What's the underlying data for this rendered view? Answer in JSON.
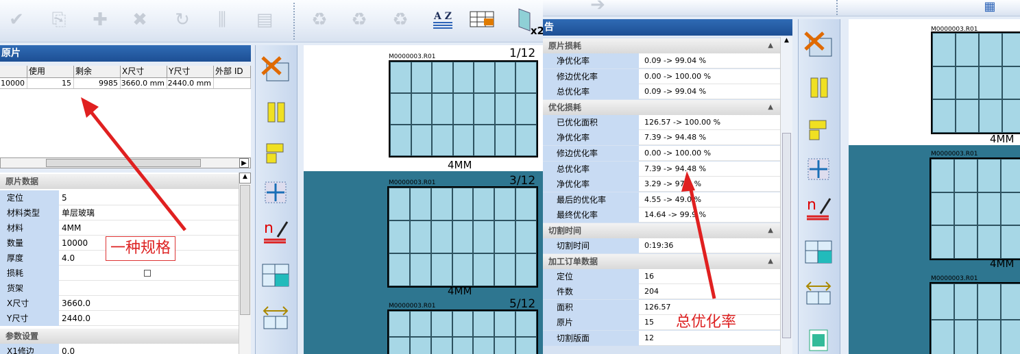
{
  "left": {
    "panel_title": "原片",
    "table": {
      "headers": [
        "使用",
        "剩余",
        "X尺寸",
        "Y尺寸",
        "外部 ID"
      ],
      "row": [
        "10000",
        "15",
        "9985",
        "3660.0 mm",
        "2440.0 mm"
      ]
    },
    "props": {
      "category": "原片数据",
      "rows": [
        {
          "k": "定位",
          "v": "5"
        },
        {
          "k": "材料类型",
          "v": "单层玻璃"
        },
        {
          "k": "材料",
          "v": "4MM"
        },
        {
          "k": "数量",
          "v": "10000"
        },
        {
          "k": "厚度",
          "v": "4.0"
        },
        {
          "k": "损耗",
          "v": ""
        },
        {
          "k": "货架",
          "v": ""
        },
        {
          "k": "X尺寸",
          "v": "3660.0"
        },
        {
          "k": "Y尺寸",
          "v": "2440.0"
        }
      ],
      "category2": "参数设置",
      "row_last": {
        "k": "X1修边",
        "v": "0.0"
      }
    },
    "annotation": "一种规格",
    "toolbar_icons": [
      "check-icon",
      "transfer-icon",
      "add-icon",
      "delete-icon",
      "undo-icon",
      "sort-icon",
      "layout-icon",
      "refresh-icon",
      "refresh-icon",
      "refresh-icon",
      "az-sort-icon",
      "edit-grid-icon",
      "copy-x2-icon"
    ],
    "x2": "x2",
    "az": "A Z",
    "sheets": [
      {
        "id": "M0000003.R01",
        "page": "1/12",
        "material": "4MM"
      },
      {
        "id": "M0000003.R01",
        "page": "3/12",
        "material": "4MM"
      },
      {
        "id": "M0000003.R01",
        "page": "5/12",
        "material": ""
      }
    ]
  },
  "right": {
    "panel_title": "告",
    "sections": [
      {
        "title": "原片损耗",
        "rows": [
          {
            "k": "净优化率",
            "v": "0.09 -> 99.04 %"
          },
          {
            "k": "修边优化率",
            "v": "0.00 -> 100.00 %"
          },
          {
            "k": "总优化率",
            "v": "0.09 -> 99.04 %"
          }
        ]
      },
      {
        "title": "优化损耗",
        "rows": [
          {
            "k": "已优化面积",
            "v": "126.57 -> 100.00 %"
          },
          {
            "k": "净优化率",
            "v": "7.39 -> 94.48 %"
          },
          {
            "k": "修边优化率",
            "v": "0.00 -> 100.00 %"
          },
          {
            "k": "总优化率",
            "v": "7.39 -> 94.48 %"
          },
          {
            "k": "净优化率",
            "v": "3.29 -> 97.5 %"
          },
          {
            "k": "最后的优化率",
            "v": "4.55 -> 49.0 %"
          },
          {
            "k": "最终优化率",
            "v": "14.64 -> 99.9 %"
          }
        ]
      },
      {
        "title": "切割时间",
        "rows": [
          {
            "k": "切割时间",
            "v": "0:19:36"
          }
        ]
      },
      {
        "title": "加工订单数据",
        "rows": [
          {
            "k": "定位",
            "v": "16"
          },
          {
            "k": "件数",
            "v": "204"
          },
          {
            "k": "面积",
            "v": "126.57"
          },
          {
            "k": "原片",
            "v": "15"
          },
          {
            "k": "切割版面",
            "v": "12"
          }
        ]
      }
    ],
    "annotation": "总优化率",
    "sheets": [
      {
        "id": "M0000003.R01",
        "material": "4MM"
      },
      {
        "id": "M0000003.R01",
        "material": "4MM"
      },
      {
        "id": "M0000003.R01",
        "material": ""
      }
    ]
  },
  "colors": {
    "glass": "#a7d7e6",
    "panel_title": "#1d4f94",
    "preview_bg": "#2e7690",
    "annotation": "#dd2222"
  }
}
